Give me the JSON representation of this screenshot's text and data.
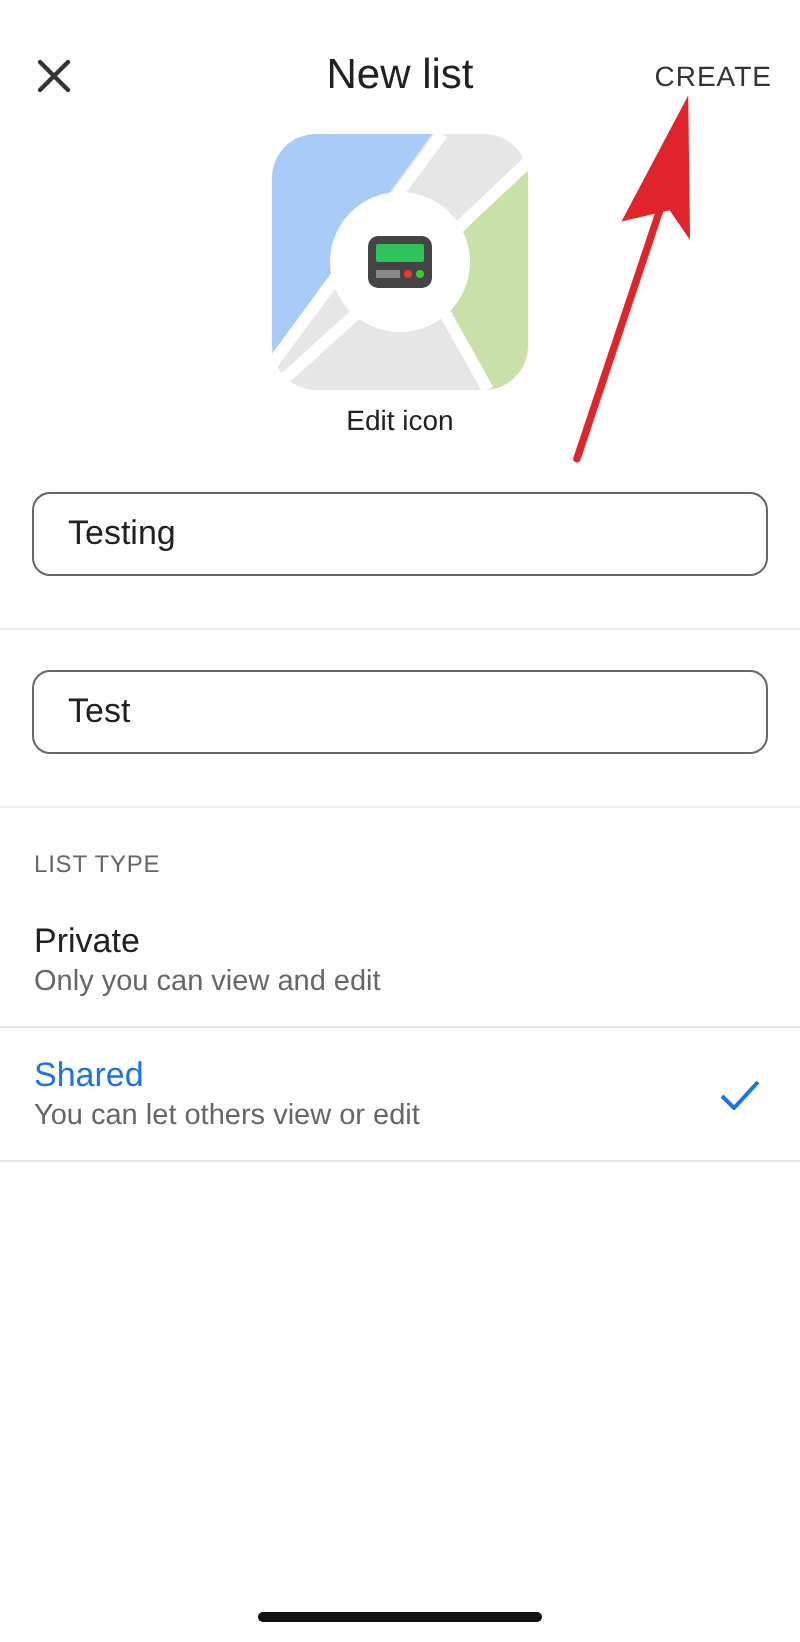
{
  "header": {
    "title": "New list",
    "action": "CREATE"
  },
  "icon_picker": {
    "label": "Edit icon"
  },
  "fields": [
    {
      "value": "Testing"
    },
    {
      "value": "Test"
    }
  ],
  "list_type": {
    "heading": "LIST TYPE",
    "options": [
      {
        "title": "Private",
        "subtitle": "Only you can view and edit",
        "selected": false
      },
      {
        "title": "Shared",
        "subtitle": "You can let others view or edit",
        "selected": true
      }
    ]
  }
}
